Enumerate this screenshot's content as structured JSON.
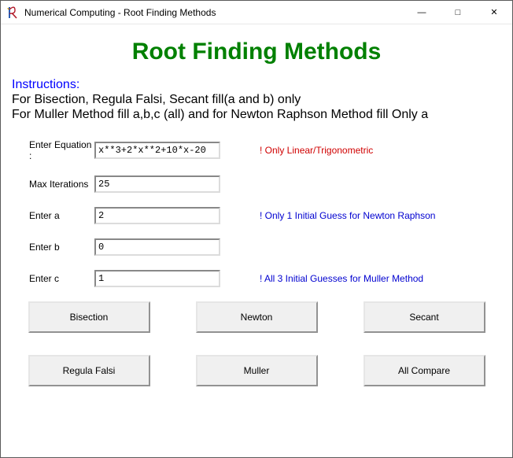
{
  "window": {
    "title": "Numerical Computing - Root Finding Methods"
  },
  "header": {
    "title": "Root Finding Methods"
  },
  "instructions": {
    "label": "Instructions:",
    "line1": "For Bisection, Regula Falsi, Secant fill(a and b) only",
    "line2": "For Muller Method fill a,b,c (all) and for Newton Raphson Method fill Only a"
  },
  "fields": {
    "equation": {
      "label": "Enter Equation :",
      "value": "x**3+2*x**2+10*x-20",
      "hint": "! Only Linear/Trigonometric"
    },
    "max_iter": {
      "label": "Max Iterations",
      "value": "25"
    },
    "a": {
      "label": "Enter a",
      "value": "2",
      "hint": "! Only 1 Initial Guess for Newton Raphson"
    },
    "b": {
      "label": "Enter b",
      "value": "0"
    },
    "c": {
      "label": "Enter c",
      "value": "1",
      "hint": "! All 3 Initial Guesses for Muller Method"
    }
  },
  "buttons": {
    "bisection": "Bisection",
    "newton": "Newton",
    "secant": "Secant",
    "regula": "Regula Falsi",
    "muller": "Muller",
    "compare": "All Compare"
  }
}
